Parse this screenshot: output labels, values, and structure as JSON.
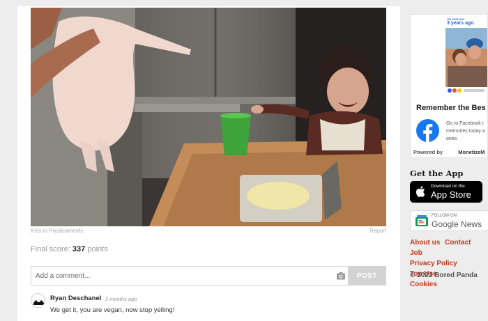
{
  "post": {
    "category_credit": "Kids in Predicaments",
    "report_label": "Report",
    "score_label": "Final score:",
    "score_value": "337",
    "score_unit": "points"
  },
  "comment_form": {
    "placeholder": "Add a comment...",
    "post_label": "POST"
  },
  "comments": [
    {
      "author": "Ryan Deschanel",
      "time": "2 months ago",
      "text": "We get it, you are vegan, now stop yelling!"
    }
  ],
  "sidebar": {
    "ad": {
      "thumb_small": "ON THIS DAY",
      "thumb_big": "3 years ago",
      "headline": "Remember the Bes",
      "body_lines": [
        "Go to Facebook t",
        "memories today a",
        "ones."
      ],
      "powered_label": "Powered by",
      "powered_brand": "MonetizeM"
    },
    "get_app_title": "Get the App",
    "appstore": {
      "small": "Download on the",
      "big": "App Store"
    },
    "gnews": {
      "small": "FOLLOW ON",
      "big": "Google News"
    },
    "links": [
      "About us",
      "Contact",
      "Job",
      "Privacy Policy",
      "Top Use",
      "Cookies"
    ],
    "copyright": "© 2022 Bored Panda"
  },
  "colors": {
    "link_red": "#c23a1c",
    "facebook_blue": "#1877f2",
    "post_button_grey": "#d3d3d3"
  }
}
